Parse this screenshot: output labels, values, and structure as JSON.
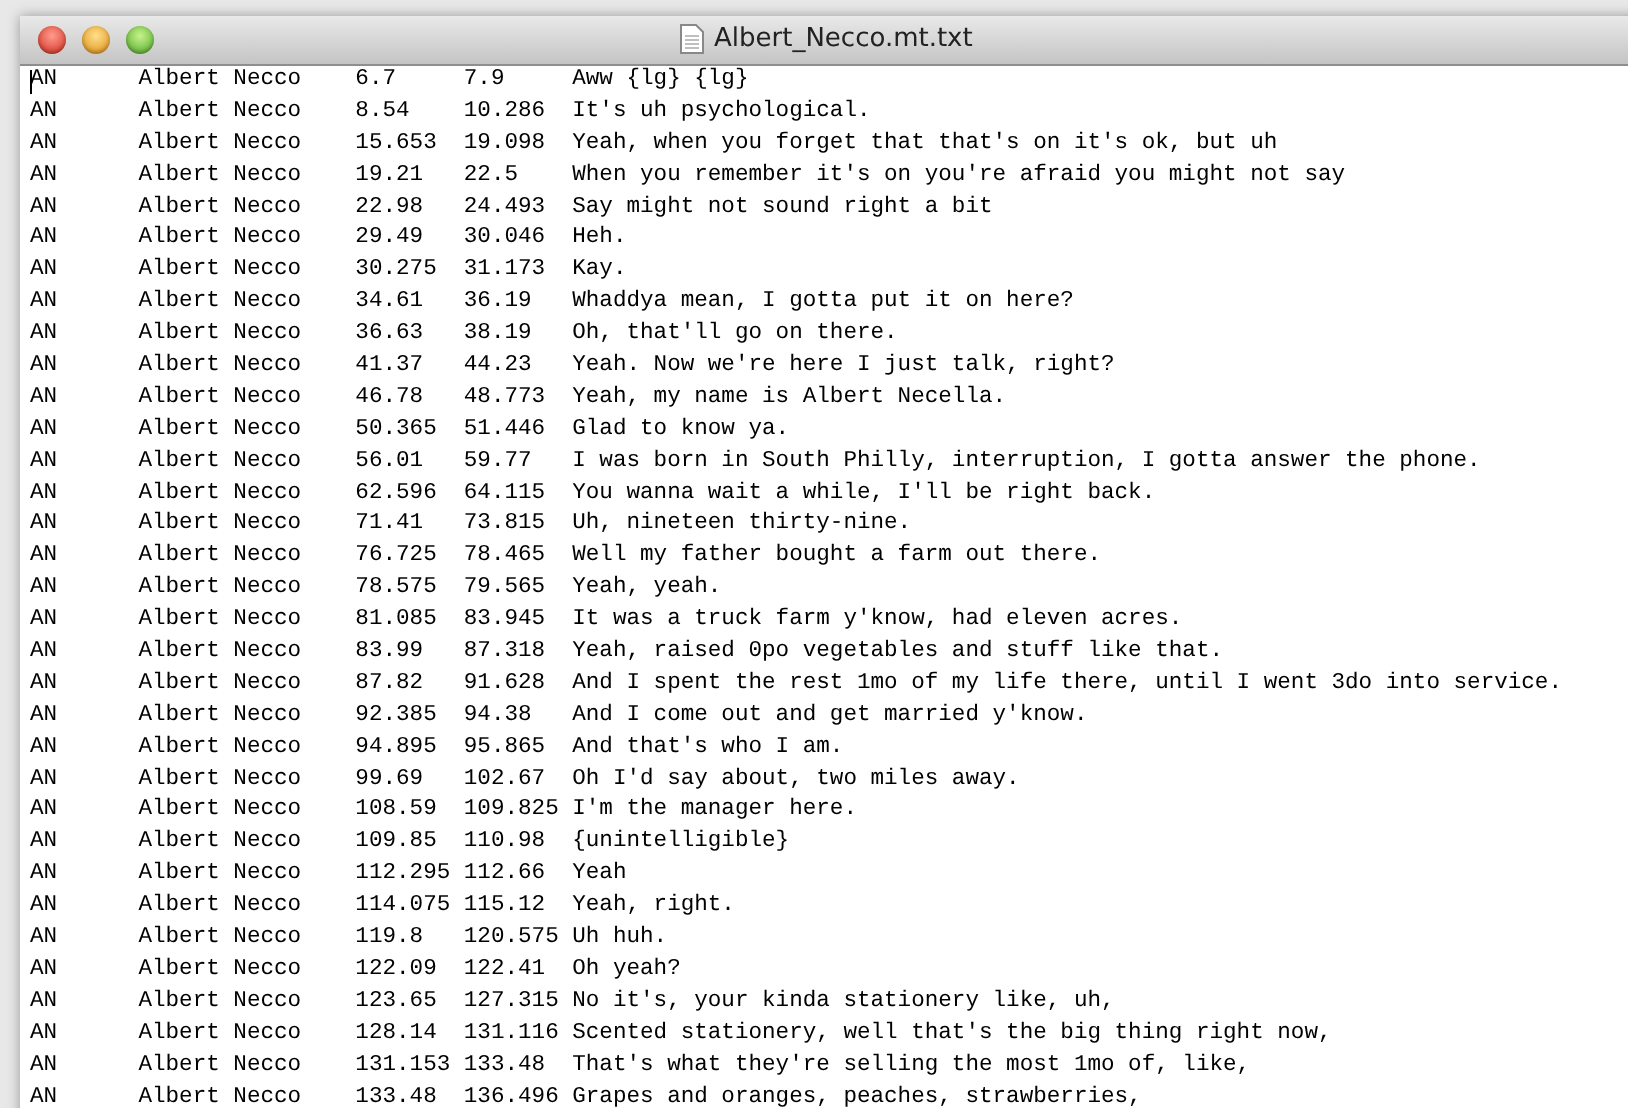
{
  "window": {
    "title": "Albert_Necco.mt.txt"
  },
  "rows": [
    {
      "code": "AN",
      "name": "Albert Necco",
      "start": "6.7",
      "end": "7.9",
      "text": "Aww {lg} {lg}"
    },
    {
      "code": "AN",
      "name": "Albert Necco",
      "start": "8.54",
      "end": "10.286",
      "text": "It's uh psychological."
    },
    {
      "code": "AN",
      "name": "Albert Necco",
      "start": "15.653",
      "end": "19.098",
      "text": "Yeah, when you forget that that's on it's ok, but uh"
    },
    {
      "code": "AN",
      "name": "Albert Necco",
      "start": "19.21",
      "end": "22.5",
      "text": "When you remember it's on you're afraid you might not say"
    },
    {
      "code": "AN",
      "name": "Albert Necco",
      "start": "22.98",
      "end": "24.493",
      "text": "Say might not sound right a bit"
    },
    {
      "code": "AN",
      "name": "Albert Necco",
      "start": "29.49",
      "end": "30.046",
      "text": "Heh."
    },
    {
      "code": "AN",
      "name": "Albert Necco",
      "start": "30.275",
      "end": "31.173",
      "text": "Kay."
    },
    {
      "code": "AN",
      "name": "Albert Necco",
      "start": "34.61",
      "end": "36.19",
      "text": "Whaddya mean, I gotta put it on here?"
    },
    {
      "code": "AN",
      "name": "Albert Necco",
      "start": "36.63",
      "end": "38.19",
      "text": "Oh, that'll go on there."
    },
    {
      "code": "AN",
      "name": "Albert Necco",
      "start": "41.37",
      "end": "44.23",
      "text": "Yeah. Now we're here I just talk, right?"
    },
    {
      "code": "AN",
      "name": "Albert Necco",
      "start": "46.78",
      "end": "48.773",
      "text": "Yeah, my name is Albert Necella."
    },
    {
      "code": "AN",
      "name": "Albert Necco",
      "start": "50.365",
      "end": "51.446",
      "text": "Glad to know ya."
    },
    {
      "code": "AN",
      "name": "Albert Necco",
      "start": "56.01",
      "end": "59.77",
      "text": "I was born in South Philly, interruption, I gotta answer the phone."
    },
    {
      "code": "AN",
      "name": "Albert Necco",
      "start": "62.596",
      "end": "64.115",
      "text": "You wanna wait a while, I'll be right back."
    },
    {
      "code": "AN",
      "name": "Albert Necco",
      "start": "71.41",
      "end": "73.815",
      "text": "Uh, nineteen thirty-nine."
    },
    {
      "code": "AN",
      "name": "Albert Necco",
      "start": "76.725",
      "end": "78.465",
      "text": "Well my father bought a farm out there."
    },
    {
      "code": "AN",
      "name": "Albert Necco",
      "start": "78.575",
      "end": "79.565",
      "text": "Yeah, yeah."
    },
    {
      "code": "AN",
      "name": "Albert Necco",
      "start": "81.085",
      "end": "83.945",
      "text": "It was a truck farm y'know, had eleven acres."
    },
    {
      "code": "AN",
      "name": "Albert Necco",
      "start": "83.99",
      "end": "87.318",
      "text": "Yeah, raised 0po vegetables and stuff like that."
    },
    {
      "code": "AN",
      "name": "Albert Necco",
      "start": "87.82",
      "end": "91.628",
      "text": "And I spent the rest 1mo of my life there, until I went 3do into service."
    },
    {
      "code": "AN",
      "name": "Albert Necco",
      "start": "92.385",
      "end": "94.38",
      "text": "And I come out and get married y'know."
    },
    {
      "code": "AN",
      "name": "Albert Necco",
      "start": "94.895",
      "end": "95.865",
      "text": "And that's who I am."
    },
    {
      "code": "AN",
      "name": "Albert Necco",
      "start": "99.69",
      "end": "102.67",
      "text": "Oh I'd say about, two miles away."
    },
    {
      "code": "AN",
      "name": "Albert Necco",
      "start": "108.59",
      "end": "109.825",
      "text": "I'm the manager here."
    },
    {
      "code": "AN",
      "name": "Albert Necco",
      "start": "109.85",
      "end": "110.98",
      "text": "{unintelligible}"
    },
    {
      "code": "AN",
      "name": "Albert Necco",
      "start": "112.295",
      "end": "112.66",
      "text": "Yeah"
    },
    {
      "code": "AN",
      "name": "Albert Necco",
      "start": "114.075",
      "end": "115.12",
      "text": "Yeah, right."
    },
    {
      "code": "AN",
      "name": "Albert Necco",
      "start": "119.8",
      "end": "120.575",
      "text": "Uh huh."
    },
    {
      "code": "AN",
      "name": "Albert Necco",
      "start": "122.09",
      "end": "122.41",
      "text": "Oh yeah?"
    },
    {
      "code": "AN",
      "name": "Albert Necco",
      "start": "123.65",
      "end": "127.315",
      "text": "No it's, your kinda stationery like, uh,"
    },
    {
      "code": "AN",
      "name": "Albert Necco",
      "start": "128.14",
      "end": "131.116",
      "text": "Scented stationery, well that's the big thing right now,"
    },
    {
      "code": "AN",
      "name": "Albert Necco",
      "start": "131.153",
      "end": "133.48",
      "text": "That's what they're selling the most 1mo of, like,"
    },
    {
      "code": "AN",
      "name": "Albert Necco",
      "start": "133.48",
      "end": "136.496",
      "text": "Grapes and oranges, peaches, strawberries,"
    }
  ]
}
